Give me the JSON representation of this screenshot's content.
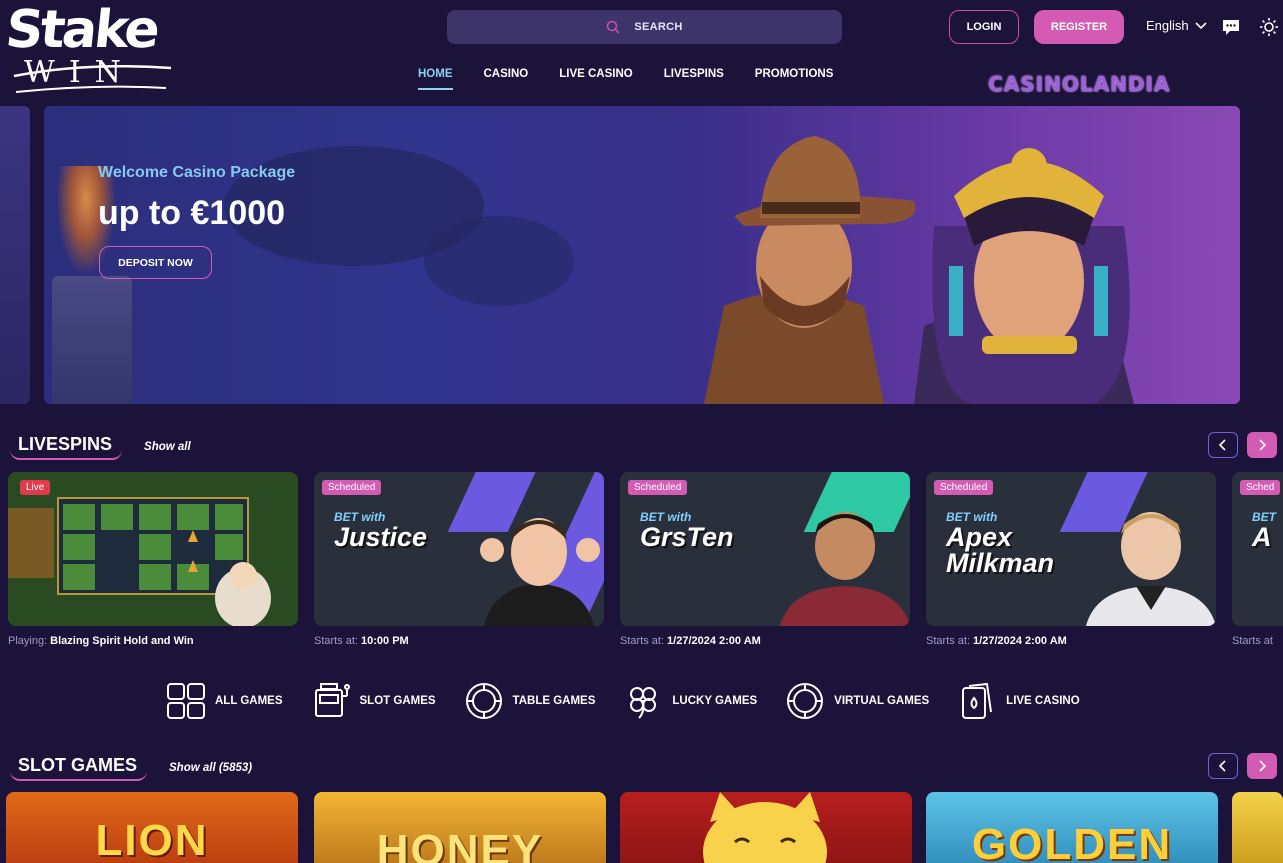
{
  "header": {
    "logo_top": "Stake",
    "logo_bottom": "WIN",
    "search_label": "SEARCH",
    "login_label": "LOGIN",
    "register_label": "REGISTER",
    "language": "English",
    "watermark": "CASINOLANDIA"
  },
  "nav": {
    "tabs": [
      {
        "label": "HOME",
        "active": true
      },
      {
        "label": "CASINO",
        "active": false
      },
      {
        "label": "LIVE CASINO",
        "active": false
      },
      {
        "label": "LIVESPINS",
        "active": false
      },
      {
        "label": "PROMOTIONS",
        "active": false
      }
    ]
  },
  "hero": {
    "subtitle": "Welcome Casino Package",
    "title": "up to €1000",
    "cta_label": "DEPOSIT NOW"
  },
  "livespins": {
    "title": "LIVESPINS",
    "show_all": "Show all",
    "cards": [
      {
        "badge": "Live",
        "sub_label": "Playing:",
        "sub_value": "Blazing Spirit Hold and Win",
        "bet_with": "",
        "name": ""
      },
      {
        "badge": "Scheduled",
        "bet_with": "BET with",
        "name": "Justice",
        "sub_label": "Starts at:",
        "sub_value": "10:00 PM"
      },
      {
        "badge": "Scheduled",
        "bet_with": "BET with",
        "name": "GrsTen",
        "sub_label": "Starts at:",
        "sub_value": "1/27/2024 2:00 AM"
      },
      {
        "badge": "Scheduled",
        "bet_with": "BET with",
        "name": "Apex Milkman",
        "sub_label": "Starts at:",
        "sub_value": "1/27/2024 2:00 AM"
      },
      {
        "badge": "Sched",
        "bet_with": "BET",
        "name": "A",
        "sub_label": "Starts at",
        "sub_value": ""
      }
    ]
  },
  "categories": [
    {
      "label": "ALL GAMES",
      "icon": "grid-icon"
    },
    {
      "label": "SLOT GAMES",
      "icon": "slot-machine-icon"
    },
    {
      "label": "TABLE GAMES",
      "icon": "chip-icon"
    },
    {
      "label": "LUCKY GAMES",
      "icon": "clover-icon"
    },
    {
      "label": "VIRTUAL GAMES",
      "icon": "chip-icon"
    },
    {
      "label": "LIVE CASINO",
      "icon": "cards-icon"
    }
  ],
  "slots": {
    "title": "SLOT GAMES",
    "show_all": "Show all (5853)",
    "games": [
      {
        "title": "LION"
      },
      {
        "title": "HONEY"
      },
      {
        "title": ""
      },
      {
        "title": "GOLDEN"
      }
    ]
  },
  "colors": {
    "background": "#1b1339",
    "accent_pink": "#d35bb3",
    "accent_blue": "#8ed0f2"
  }
}
